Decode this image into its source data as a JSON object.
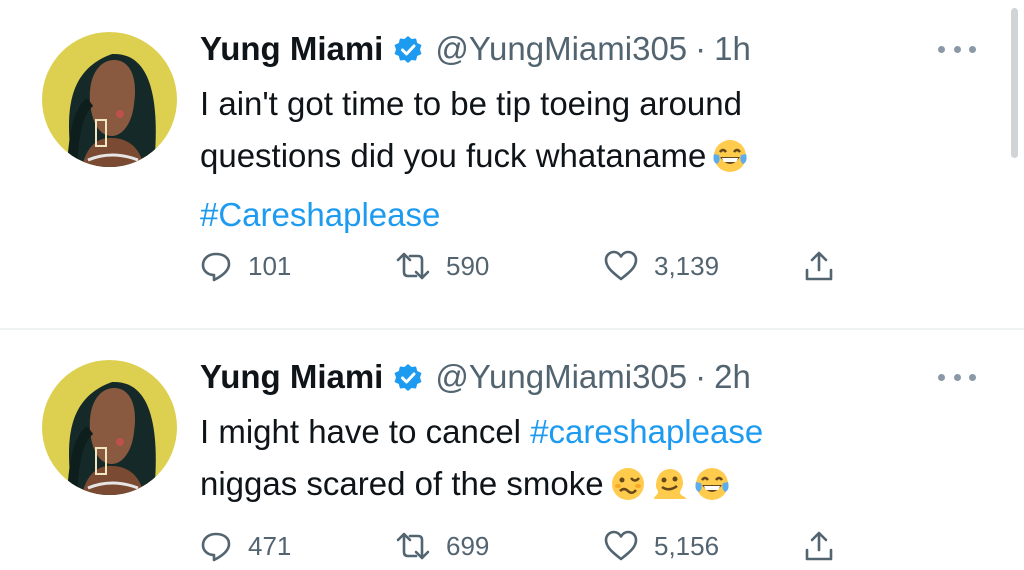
{
  "tweets": [
    {
      "author": "Yung Miami",
      "handle": "@YungMiami305",
      "separator": "·",
      "time": "1h",
      "text_lines": [
        "I ain't got time to be tip toeing around",
        "questions did you fuck whataname"
      ],
      "hashtag": "#Careshaplease",
      "emojis": [
        "face-with-tears-of-joy"
      ],
      "replies": "101",
      "retweets": "590",
      "likes": "3,139"
    },
    {
      "author": "Yung Miami",
      "handle": "@YungMiami305",
      "separator": "·",
      "time": "2h",
      "text_prefix": "I might have to cancel ",
      "hashtag": "#careshaplease",
      "text_line2": "niggas scared of the smoke",
      "emojis": [
        "woozy-face",
        "melting-face",
        "face-with-tears-of-joy"
      ],
      "replies": "471",
      "retweets": "699",
      "likes": "5,156"
    }
  ],
  "icons": [
    "verified-badge-icon",
    "more-icon",
    "reply-icon",
    "retweet-icon",
    "like-icon",
    "share-icon"
  ],
  "colors": {
    "link": "#1d9bf0",
    "verified": "#1d9bf0",
    "muted": "#536471",
    "avatar_bg": "#ddd050"
  }
}
